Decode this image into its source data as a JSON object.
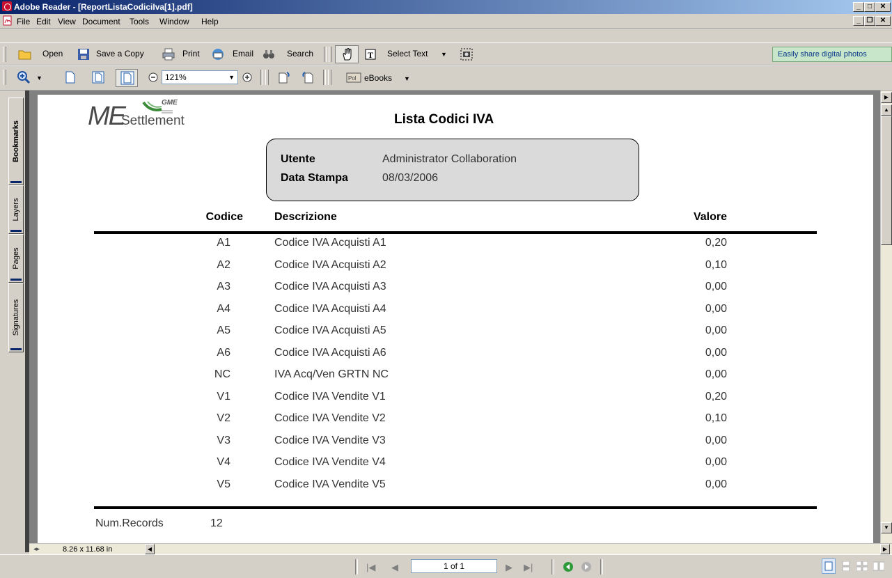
{
  "window": {
    "title": "Adobe Reader - [ReportListaCodiciIva[1].pdf]"
  },
  "menu": [
    "File",
    "Edit",
    "View",
    "Document",
    "Tools",
    "Window",
    "Help"
  ],
  "toolbar1": {
    "open": "Open",
    "save_copy": "Save a Copy",
    "print": "Print",
    "email": "Email",
    "search": "Search",
    "select_text": "Select Text",
    "share": "Easily share digital photos"
  },
  "toolbar2": {
    "zoom": "121%",
    "ebooks": "eBooks"
  },
  "side_tabs": [
    "Bookmarks",
    "Layers",
    "Pages",
    "Signatures"
  ],
  "document": {
    "logo_me": "ME",
    "logo_settlement": "Settlement",
    "logo_gme": "GME",
    "title": "Lista Codici IVA",
    "info": {
      "user_label": "Utente",
      "user_value": "Administrator Collaboration",
      "date_label": "Data Stampa",
      "date_value": "08/03/2006"
    },
    "columns": {
      "code": "Codice",
      "description": "Descrizione",
      "value": "Valore"
    },
    "rows": [
      {
        "code": "A1",
        "description": "Codice IVA Acquisti A1",
        "value": "0,20"
      },
      {
        "code": "A2",
        "description": "Codice IVA Acquisti A2",
        "value": "0,10"
      },
      {
        "code": "A3",
        "description": "Codice IVA Acquisti A3",
        "value": "0,00"
      },
      {
        "code": "A4",
        "description": "Codice IVA Acquisti A4",
        "value": "0,00"
      },
      {
        "code": "A5",
        "description": "Codice IVA Acquisti A5",
        "value": "0,00"
      },
      {
        "code": "A6",
        "description": "Codice IVA Acquisti A6",
        "value": "0,00"
      },
      {
        "code": "NC",
        "description": "IVA Acq/Ven GRTN NC",
        "value": "0,00"
      },
      {
        "code": "V1",
        "description": "Codice IVA Vendite V1",
        "value": "0,20"
      },
      {
        "code": "V2",
        "description": "Codice IVA Vendite V2",
        "value": "0,10"
      },
      {
        "code": "V3",
        "description": "Codice IVA Vendite V3",
        "value": "0,00"
      },
      {
        "code": "V4",
        "description": "Codice IVA Vendite V4",
        "value": "0,00"
      },
      {
        "code": "V5",
        "description": "Codice IVA Vendite V5",
        "value": "0,00"
      }
    ],
    "footer_label": "Num.Records",
    "footer_value": "12"
  },
  "page_size": "8.26 x 11.68 in",
  "page_indicator": "1 of 1"
}
